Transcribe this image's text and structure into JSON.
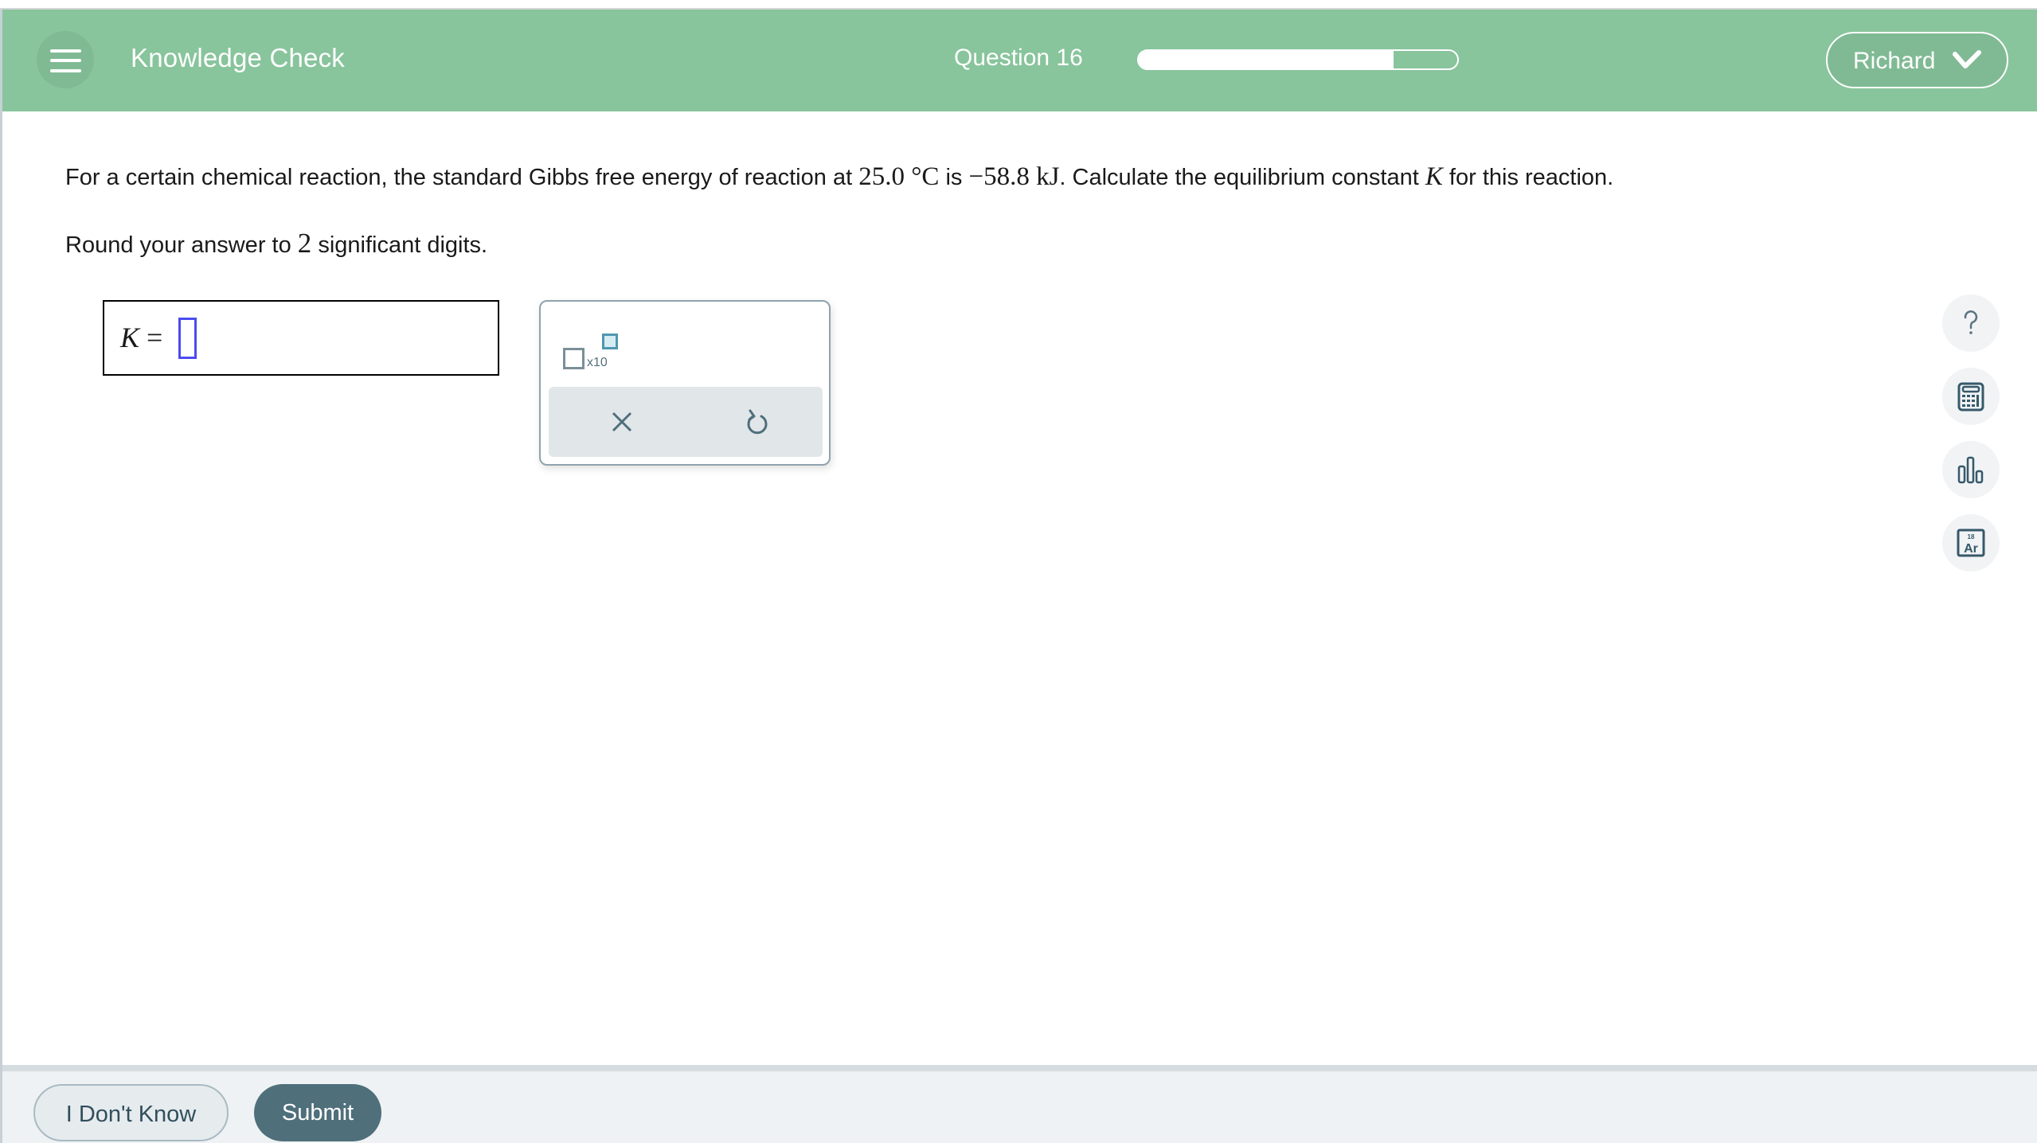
{
  "header": {
    "app_title": "Knowledge Check",
    "question_label": "Question 16",
    "progress_fraction": 0.8,
    "user_name": "Richard",
    "menu_icon": "hamburger-menu-icon",
    "user_menu_icon": "chevron-down-icon",
    "colors": {
      "header_bg": "#88c49c",
      "text": "#ffffff"
    }
  },
  "question": {
    "part1": "For a certain chemical reaction, the standard Gibbs free energy of reaction at ",
    "temperature": "25.0 °C",
    "part2": " is ",
    "energy": "−58.8 kJ",
    "part3": ". Calculate the equilibrium constant ",
    "variable": "K",
    "part4": " for this reaction.",
    "round_part1": "Round your answer to ",
    "round_digits": "2",
    "round_part2": " significant digits."
  },
  "answer": {
    "variable": "K",
    "equals": " =",
    "value": ""
  },
  "tool_panel": {
    "sci_notation_label": "x10",
    "sci_notation_icon": "scientific-notation-icon",
    "clear_icon": "x-icon",
    "undo_icon": "undo-icon"
  },
  "side_tools": [
    {
      "name": "help",
      "icon": "question-mark-icon"
    },
    {
      "name": "calculator",
      "icon": "calculator-icon"
    },
    {
      "name": "data",
      "icon": "bar-chart-icon"
    },
    {
      "name": "periodic-table",
      "icon": "periodic-table-icon",
      "element_number": "18",
      "element_symbol": "Ar"
    }
  ],
  "footer": {
    "dont_know_label": "I Don't Know",
    "submit_label": "Submit"
  }
}
